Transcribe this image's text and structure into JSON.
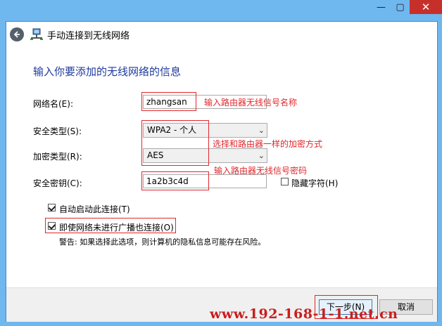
{
  "window": {
    "title": "手动连接到无线网络",
    "controls": {
      "minimize": "—",
      "maximize": "▢",
      "close": "✕"
    }
  },
  "form": {
    "heading": "输入你要添加的无线网络的信息",
    "ssid_label": "网络名(E):",
    "ssid_value": "zhangsan",
    "security_label": "安全类型(S):",
    "security_value": "WPA2 - 个人",
    "encryption_label": "加密类型(R):",
    "encryption_value": "AES",
    "key_label": "安全密钥(C):",
    "key_value": "1a2b3c4d",
    "hide_chars_label": "隐藏字符(H)",
    "hide_chars_checked": false,
    "auto_connect_label": "自动启动此连接(T)",
    "auto_connect_checked": true,
    "connect_hidden_label": "即使网络未进行广播也连接(O)",
    "connect_hidden_checked": true,
    "warning": "警告: 如果选择此选项，则计算机的隐私信息可能存在风险。"
  },
  "annotations": {
    "ssid_note": "输入路由器无线信号名称",
    "security_note": "选择和路由器一样的加密方式",
    "key_note": "输入路由器无线信号密码"
  },
  "buttons": {
    "next": "下一步(N)",
    "cancel": "取消"
  },
  "watermark": "www.192-168-1-1.net.cn",
  "colors": {
    "accent_red": "#e2262b",
    "heading_blue": "#1e3a9c",
    "frame_blue": "#6fb7ef"
  }
}
